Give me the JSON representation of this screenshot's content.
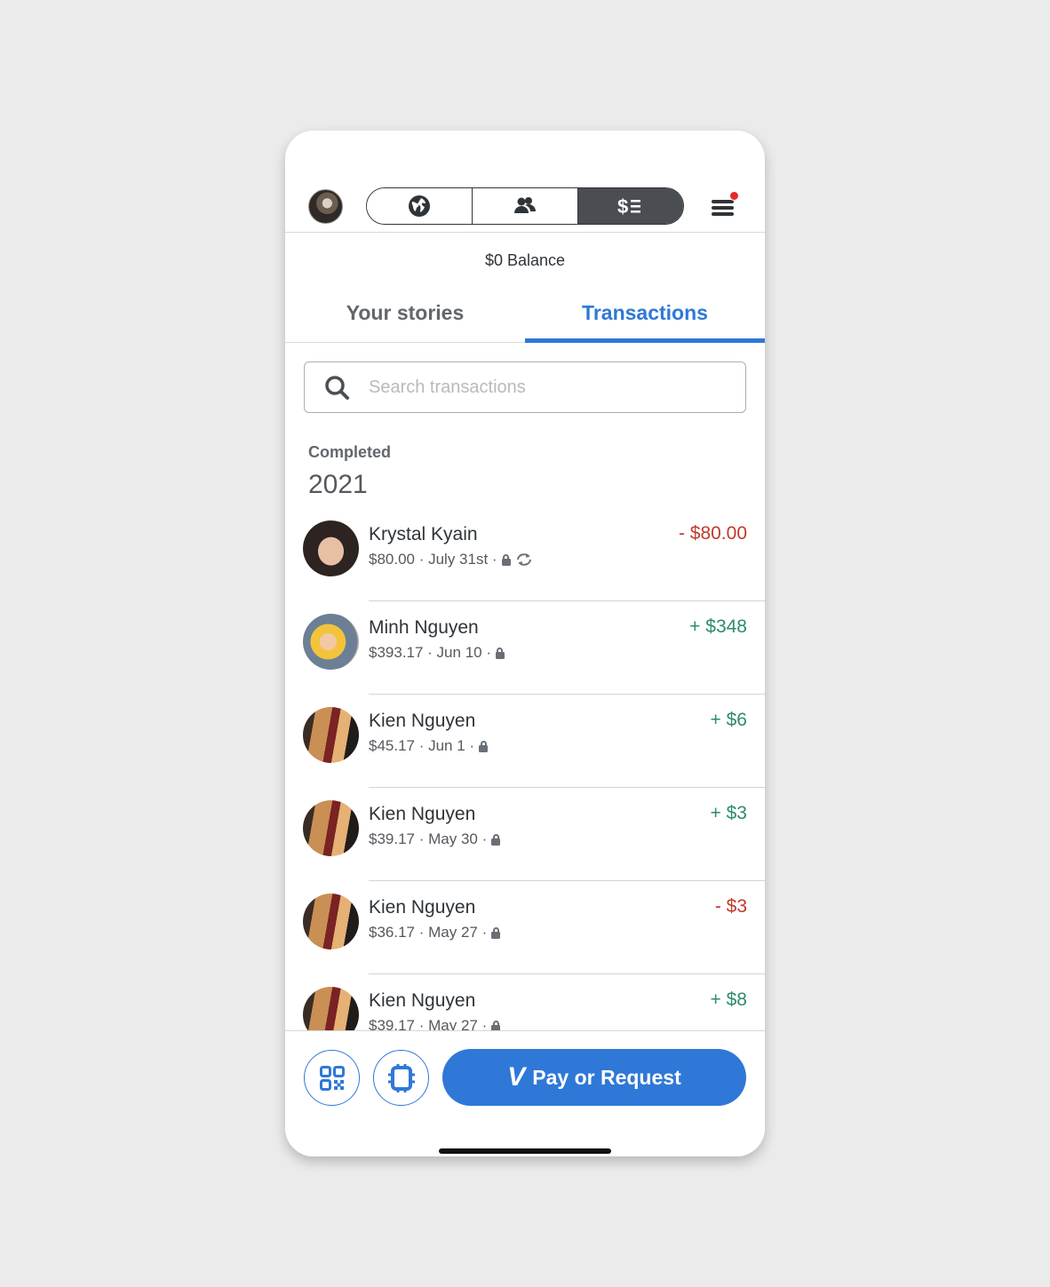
{
  "topbar": {
    "segments": [
      "globe-icon",
      "friends-icon",
      "dollar-list-icon"
    ],
    "active_segment": 2,
    "notification_color": "#e8262c"
  },
  "balance": "$0 Balance",
  "tabs": [
    {
      "label": "Your stories",
      "active": false
    },
    {
      "label": "Transactions",
      "active": true
    }
  ],
  "search": {
    "placeholder": "Search transactions"
  },
  "section": {
    "label": "Completed",
    "year": "2021"
  },
  "transactions": [
    {
      "name": "Krystal Kyain",
      "meta": "$80.00 · July 31st ·",
      "amount": "- $80.00",
      "direction": "negative",
      "recurring": true
    },
    {
      "name": "Minh Nguyen",
      "meta": "$393.17 · Jun 10 ·",
      "amount": "+ $348",
      "direction": "positive",
      "recurring": false
    },
    {
      "name": "Kien Nguyen",
      "meta": "$45.17 · Jun 1 ·",
      "amount": "+ $6",
      "direction": "positive",
      "recurring": false
    },
    {
      "name": "Kien Nguyen",
      "meta": "$39.17 · May 30 ·",
      "amount": "+ $3",
      "direction": "positive",
      "recurring": false
    },
    {
      "name": "Kien Nguyen",
      "meta": "$36.17 · May 27 ·",
      "amount": "- $3",
      "direction": "negative",
      "recurring": false
    },
    {
      "name": "Kien Nguyen",
      "meta": "$39.17 · May 27 ·",
      "amount": "+ $8",
      "direction": "positive",
      "recurring": false
    }
  ],
  "bottom": {
    "qr_icon": "qr-code-icon",
    "card_icon": "card-chip-icon",
    "pay_logo": "V",
    "pay_label": "Pay or Request"
  },
  "colors": {
    "accent": "#2f78d7",
    "negative": "#c0392b",
    "positive": "#2e8b6d"
  }
}
